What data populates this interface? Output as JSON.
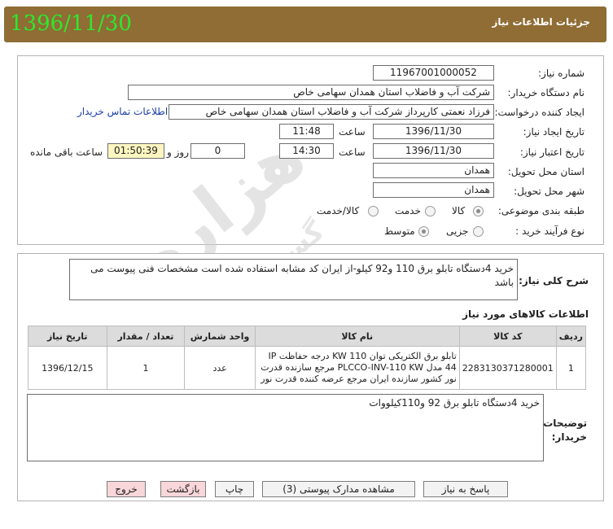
{
  "header": {
    "title": "جزئیات اطلاعات نیاز",
    "date_stamp": "1396/11/30"
  },
  "watermark": {
    "main": "هزاره",
    "sub": "گستران رایان"
  },
  "form": {
    "need_number": {
      "label": "شماره نیاز:",
      "value": "11967001000052"
    },
    "buyer_org": {
      "label": "نام دستگاه خریدار:",
      "value": "شرکت آب و فاضلاب استان همدان سهامی خاص"
    },
    "requester": {
      "label": "ایجاد کننده درخواست:",
      "value": "فرزاد نعمتی کارپرداز شرکت آب و فاضلاب استان همدان سهامی خاص",
      "contact_link": "اطلاعات تماس خریدار"
    },
    "created": {
      "label": "تاریخ ایجاد نیاز:",
      "date": "1396/11/30",
      "time_label": "ساعت",
      "time": "11:48"
    },
    "validity": {
      "label": "تاریخ اعتبار نیاز:",
      "date": "1396/11/30",
      "time_label": "ساعت",
      "time": "14:30",
      "days": "0",
      "days_label": "روز و",
      "remaining": "01:50:39",
      "remaining_label": "ساعت باقی مانده"
    },
    "province": {
      "label": "استان محل تحویل:",
      "value": "همدان"
    },
    "city": {
      "label": "شهر محل تحویل:",
      "value": "همدان"
    },
    "category": {
      "label": "طبقه بندی موضوعی:",
      "options": [
        "کالا",
        "خدمت",
        "کالا/خدمت"
      ],
      "selected": "کالا"
    },
    "process": {
      "label": "نوع فرآیند خرید :",
      "options": [
        "جزیی",
        "متوسط"
      ],
      "selected": "متوسط"
    }
  },
  "summary": {
    "label": "شرح کلی نیاز:",
    "text": "خرید 4دستگاه تابلو برق 110 و92 کیلو-از ایران کد مشابه استفاده شده است مشخصات فنی پیوست می باشد"
  },
  "items": {
    "title": "اطلاعات کالاهای مورد نیاز",
    "columns": [
      "ردیف",
      "کد کالا",
      "نام کالا",
      "واحد شمارش",
      "تعداد / مقدار",
      "تاریخ نیاز"
    ],
    "rows": [
      {
        "row": "1",
        "code": "2283130371280001",
        "name": "تابلو برق الکتریکی توان 110 KW درجه حفاظت IP 44 مدل PLCCO-INV-110 KW مرجع سازنده قدرت نور کشور سازنده ایران مرجع عرضه کننده قدرت نور",
        "unit": "عدد",
        "qty": "1",
        "date": "1396/12/15"
      }
    ]
  },
  "buyer_notes": {
    "label": "توضیحات خریدار:",
    "text": "خرید 4دستگاه تابلو برق 92 و110کیلووات"
  },
  "buttons": {
    "reply": "پاسخ به نیاز",
    "attachments": "مشاهده مدارک پیوستی (3)",
    "print": "چاپ",
    "back": "بازگشت",
    "exit": "خروج"
  }
}
